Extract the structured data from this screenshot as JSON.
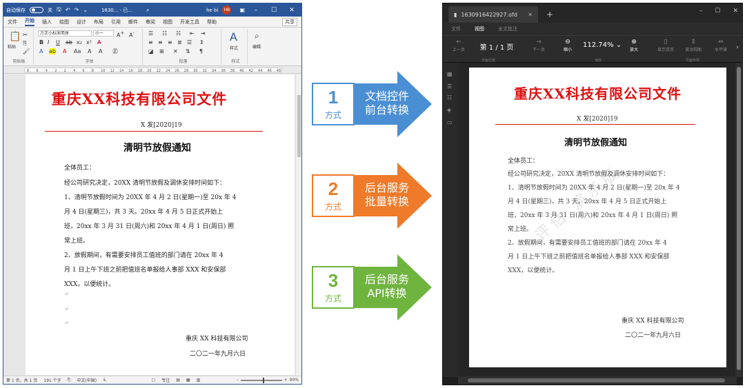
{
  "word": {
    "titlebar": {
      "autosave_label": "自动保存",
      "autosave_state": "关",
      "filename": "1630... - 已...",
      "user_name": "he bi",
      "user_initials": "HB",
      "minimize": "–",
      "restore": "☐",
      "close": "✕"
    },
    "tabs": [
      "文件",
      "开始",
      "插入",
      "绘图",
      "设计",
      "布局",
      "引用",
      "邮件",
      "审阅",
      "视图",
      "开发工具",
      "帮助"
    ],
    "active_tab": "开始",
    "share_label": "共享",
    "ribbon": {
      "paste_label": "粘贴",
      "clipboard_group": "剪贴板",
      "font_name": "方正小标宋简体",
      "font_size": "小一",
      "font_group": "字体",
      "paragraph_group": "段落",
      "styles_label": "样式",
      "editing_label": "编辑",
      "styles_group": "样式"
    },
    "ruler_marks": [
      "8",
      "6",
      "4",
      "2",
      "2",
      "4",
      "6",
      "8",
      "10",
      "12",
      "14",
      "16",
      "18",
      "20",
      "22",
      "24",
      "26",
      "28",
      "30",
      "32",
      "34",
      "36",
      "38",
      "40",
      "42",
      "44",
      "46",
      "48"
    ],
    "status": {
      "page": "第 1 页，共 1 页",
      "words": "191 个字",
      "language": "中文(中国)",
      "focus": "专注",
      "zoom": "90%",
      "zoom_minus": "–",
      "zoom_plus": "+"
    }
  },
  "document": {
    "header_title": "重庆XX科技有限公司文件",
    "doc_number": "X 发[2020]19",
    "notice_title": "清明节放假通知",
    "salutation": "全体员工：",
    "body": [
      "经公司研究决定，20XX 清明节放假及调休安排时间如下：",
      "1、清明节放假时间为 20XX 年 4 月 2 日(星期一)至 20x 年 4",
      "月 4 日(星期三)，共 3 天。20xx 年 4 月 5 日正式开始上",
      "班，20xx 年 3 月 31 日(周六)和 20xx 年 4 月 1 日(周日) 照",
      "常上班。",
      "2、放假期间，有需要安排员工值班的部门请在 20xx 年 4",
      "月 1 日上午下班之前把值班名单报给人事部 XXX 和安保部",
      "XXX，以便统计。"
    ],
    "signature_company": "重庆 XX 科技有限公司",
    "signature_date": "二〇二一年九月六日",
    "paragraph_mark": "↵"
  },
  "ofd_body": [
    "经公司研究决定，20XX 清明节放假及调休安排时间如下：",
    "1、清明节放假时间为 20XX 年 4 月 2 日(星期一)至 20x 年 4",
    "月 4 日(星期三)，共 3 天。20xx 年 4 月 5 日正式开始上",
    "班，20xx 年 3 月 31 日(周六)和 20xx 年 4 月 1 日(周日) 照",
    "常上班。",
    "2、放假期间，有需要安排员工值班的部门请在 20xx 年 4",
    "月 1 日上午下班之前把值班名单报给人事部 XXX 和安保部",
    "XXX，以便统计。"
  ],
  "ofd_signature_company": "重庆 XX 科技有限公司",
  "methods": [
    {
      "num": "1",
      "label": "方式",
      "line1": "文档控件",
      "line2": "前台转换",
      "color": "#4a8fd4"
    },
    {
      "num": "2",
      "label": "方式",
      "line1": "后台服务",
      "line2": "批量转换",
      "color": "#ef7a2a"
    },
    {
      "num": "3",
      "label": "方式",
      "line1": "后台服务",
      "line2": "API转换",
      "color": "#6fb43f"
    }
  ],
  "ofd": {
    "tab_filename": "1630916422927.ofd",
    "tab_close": "✕",
    "new_tab": "+",
    "menu": [
      "文件",
      "视图",
      "全文批注"
    ],
    "menu_active": "视图",
    "prev_page": "上一页",
    "page_indicator": "第 1 / 1 页",
    "next_page": "下一页",
    "page_group": "页面位置",
    "zoom_out": "缩小",
    "zoom_value": "112.74%",
    "zoom_in": "放大",
    "zoom_group": "缩放",
    "single_page": "显示双页",
    "continuous": "滚动视图",
    "fit_width": "水平滚",
    "layout_group": "页面布局",
    "watermark": "评估 演示版"
  }
}
